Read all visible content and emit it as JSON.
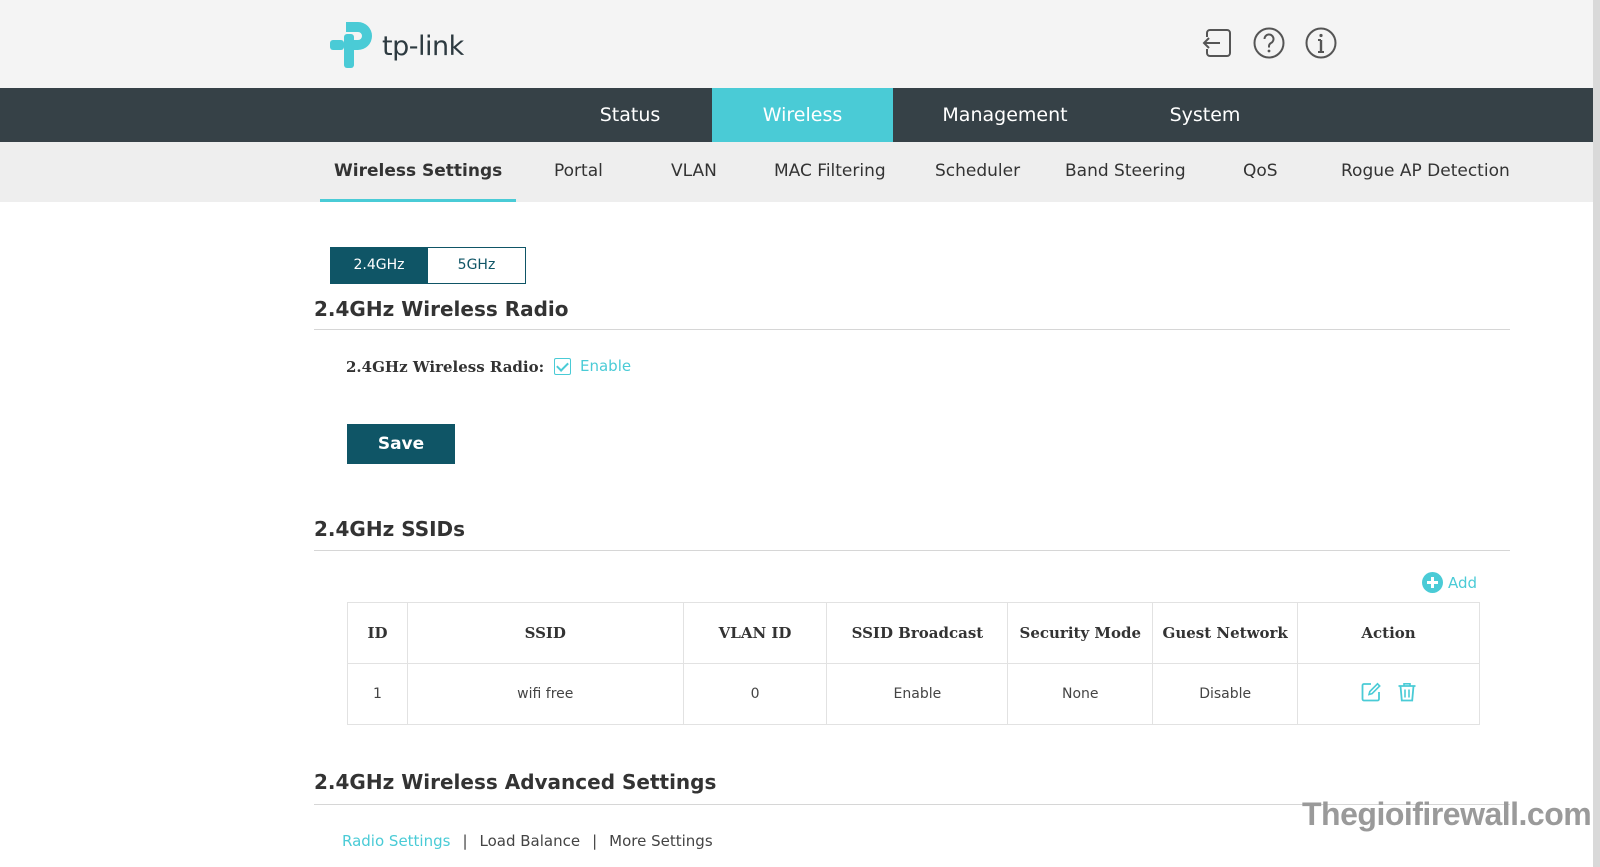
{
  "brand": {
    "name": "tp-link",
    "accent_color": "#4acbd6",
    "dark_color": "#0f5566",
    "nav_bg": "#364147"
  },
  "header_icons": [
    "logout-icon",
    "help-icon",
    "info-icon"
  ],
  "top_nav": [
    {
      "label": "Status",
      "active": false
    },
    {
      "label": "Wireless",
      "active": true
    },
    {
      "label": "Management",
      "active": false
    },
    {
      "label": "System",
      "active": false
    }
  ],
  "sub_nav": [
    {
      "label": "Wireless Settings",
      "active": true
    },
    {
      "label": "Portal",
      "active": false
    },
    {
      "label": "VLAN",
      "active": false
    },
    {
      "label": "MAC Filtering",
      "active": false
    },
    {
      "label": "Scheduler",
      "active": false
    },
    {
      "label": "Band Steering",
      "active": false
    },
    {
      "label": "QoS",
      "active": false
    },
    {
      "label": "Rogue AP Detection",
      "active": false
    }
  ],
  "band_tabs": [
    {
      "label": "2.4GHz",
      "active": true
    },
    {
      "label": "5GHz",
      "active": false
    }
  ],
  "radio_section": {
    "title": "2.4GHz Wireless Radio",
    "field_label": "2.4GHz Wireless Radio:",
    "checkbox_label": "Enable",
    "checked": true,
    "save_label": "Save"
  },
  "ssid_section": {
    "title": "2.4GHz SSIDs",
    "add_label": "Add",
    "columns": [
      "ID",
      "SSID",
      "VLAN ID",
      "SSID Broadcast",
      "Security Mode",
      "Guest Network",
      "Action"
    ],
    "rows": [
      {
        "id": "1",
        "ssid": "wifi free",
        "vlan_id": "0",
        "broadcast": "Enable",
        "security": "None",
        "guest": "Disable",
        "actions": [
          "edit-icon",
          "delete-icon"
        ]
      }
    ]
  },
  "advanced_section": {
    "title": "2.4GHz Wireless Advanced Settings",
    "links": [
      {
        "label": "Radio Settings",
        "active": true
      },
      {
        "label": "Load Balance",
        "active": false
      },
      {
        "label": "More Settings",
        "active": false
      }
    ],
    "separator": "|"
  },
  "watermark": "Thegioifirewall.com"
}
